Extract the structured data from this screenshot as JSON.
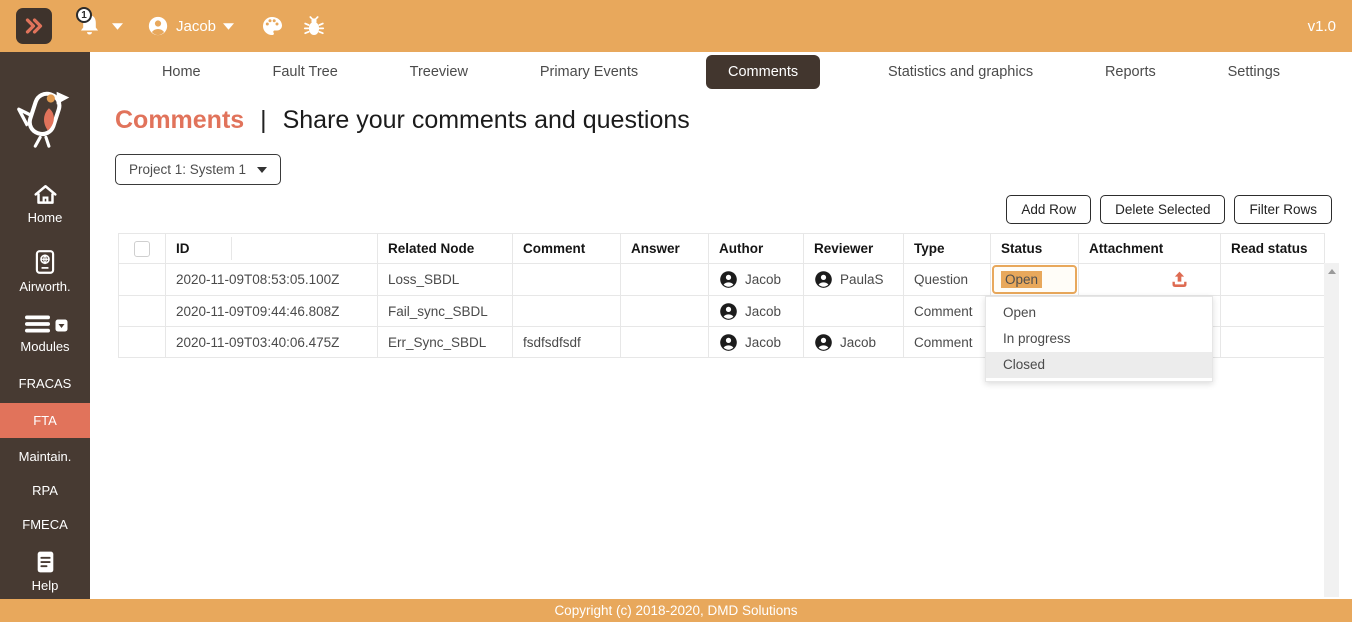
{
  "colors": {
    "topbar": "#E8A85C",
    "accent": "#E1735B",
    "sidebar": "#473A32",
    "active-tab": "#42362E",
    "toggle-btn": "#3E332C",
    "selection": "#E8A85C",
    "upload": "#DE6B52",
    "footer": "#E8A85C"
  },
  "topbar": {
    "toggle_icon": "double-chevron-right-icon",
    "notification_count": "1",
    "bell_icon": "bell-icon",
    "user_icon": "user-avatar-icon",
    "user_name": "Jacob",
    "palette_icon": "palette-icon",
    "bug_icon": "bug-icon",
    "version": "v1.0"
  },
  "sidebar": {
    "logo_icon": "robin-bird-logo",
    "items": [
      {
        "label": "Home",
        "icon": "home-icon",
        "active": false
      },
      {
        "label": "Airworth.",
        "icon": "passport-globe-icon",
        "active": false
      },
      {
        "label": "Modules",
        "icon": "menu-bars-icon",
        "active": false
      },
      {
        "label": "FRACAS",
        "icon": "",
        "active": false
      },
      {
        "label": "FTA",
        "icon": "",
        "active": true
      },
      {
        "label": "Maintain.",
        "icon": "",
        "active": false
      },
      {
        "label": "RPA",
        "icon": "",
        "active": false
      },
      {
        "label": "FMECA",
        "icon": "",
        "active": false
      },
      {
        "label": "Help",
        "icon": "book-icon",
        "active": false
      }
    ]
  },
  "tabs": [
    {
      "label": "Home",
      "active": false
    },
    {
      "label": "Fault Tree",
      "active": false
    },
    {
      "label": "Treeview",
      "active": false
    },
    {
      "label": "Primary Events",
      "active": false
    },
    {
      "label": "Comments",
      "active": true
    },
    {
      "label": "Statistics and graphics",
      "active": false
    },
    {
      "label": "Reports",
      "active": false
    },
    {
      "label": "Settings",
      "active": false
    }
  ],
  "page": {
    "title": "Comments",
    "separator": "|",
    "subtitle": "Share your comments and questions"
  },
  "project_selector": {
    "value": "Project 1: System 1"
  },
  "actions": {
    "add_row": "Add Row",
    "delete_selected": "Delete Selected",
    "filter_rows": "Filter Rows"
  },
  "table": {
    "headers": {
      "id": "ID",
      "related_node": "Related Node",
      "comment": "Comment",
      "answer": "Answer",
      "author": "Author",
      "reviewer": "Reviewer",
      "type": "Type",
      "status": "Status",
      "attachment": "Attachment",
      "read_status": "Read status"
    },
    "rows": [
      {
        "id": "2020-11-09T08:53:05.100Z",
        "related_node": "Loss_SBDL",
        "comment": "",
        "answer": "",
        "author": "Jacob",
        "reviewer": "PaulaS",
        "type": "Question",
        "status": "Open",
        "attachment": "upload-icon",
        "read_status": ""
      },
      {
        "id": "2020-11-09T09:44:46.808Z",
        "related_node": "Fail_sync_SBDL",
        "comment": "",
        "answer": "",
        "author": "Jacob",
        "reviewer": "",
        "type": "Comment",
        "status": "",
        "attachment": "",
        "read_status": ""
      },
      {
        "id": "2020-11-09T03:40:06.475Z",
        "related_node": "Err_Sync_SBDL",
        "comment": "fsdfsdfsdf",
        "answer": "",
        "author": "Jacob",
        "reviewer": "Jacob",
        "type": "Comment",
        "status": "",
        "attachment": "",
        "read_status": ""
      }
    ]
  },
  "status_editor": {
    "value": "Open",
    "options": [
      "Open",
      "In progress",
      "Closed"
    ],
    "highlighted_option": "Closed"
  },
  "footer": {
    "copyright": "Copyright (c) 2018-2020, DMD Solutions"
  }
}
